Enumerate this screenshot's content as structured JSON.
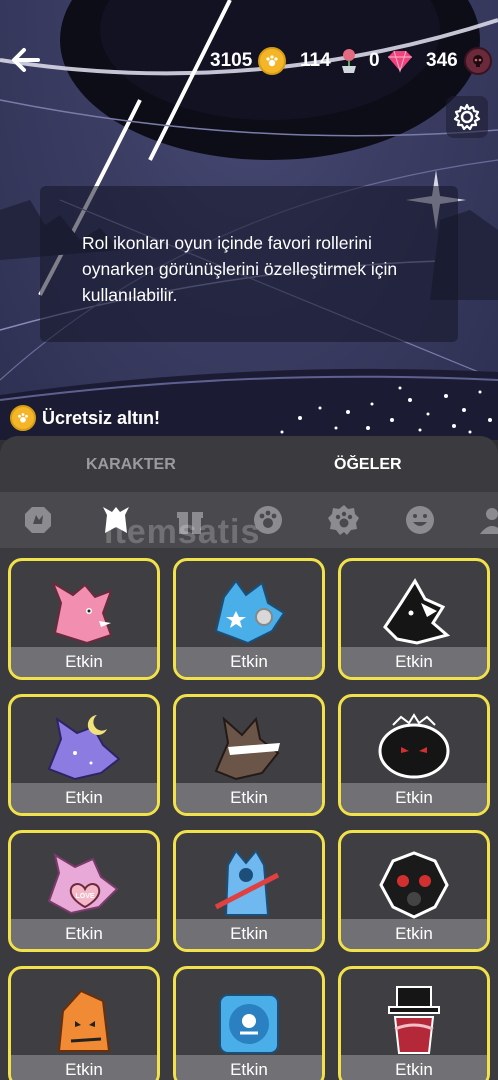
{
  "header": {
    "coins": "3105",
    "roses": "114",
    "gems_pink": "0",
    "gems_skull": "346"
  },
  "info": {
    "text": "Rol ikonları oyun içinde favori rollerini oynarken görünüşlerini özelleştirmek için kullanılabilir."
  },
  "free_gold": {
    "label": "Ücretsiz altın!"
  },
  "tabs": [
    {
      "label": "KARAKTER",
      "active": false
    },
    {
      "label": "ÖĞELER",
      "active": true
    }
  ],
  "category_icons": [
    "badge-icon",
    "wolf-head-icon",
    "gift-icon",
    "paw-icon",
    "paw-badge-icon",
    "smile-icon",
    "person-icon"
  ],
  "watermark": "itemsatis",
  "items": [
    {
      "name": "pink-wolf",
      "label": "Etkin"
    },
    {
      "name": "blue-star-wolf",
      "label": "Etkin"
    },
    {
      "name": "black-white-dragon",
      "label": "Etkin"
    },
    {
      "name": "night-moon-wolf",
      "label": "Etkin"
    },
    {
      "name": "masked-brown-wolf",
      "label": "Etkin"
    },
    {
      "name": "black-lace-wolf",
      "label": "Etkin"
    },
    {
      "name": "love-wolf",
      "label": "Etkin"
    },
    {
      "name": "blue-cat-guitar",
      "label": "Etkin"
    },
    {
      "name": "gasmask-wolf",
      "label": "Etkin"
    },
    {
      "name": "fire-note-wolf",
      "label": "Etkin"
    },
    {
      "name": "vinyl-skull",
      "label": "Etkin"
    },
    {
      "name": "tophat-snake",
      "label": "Etkin"
    }
  ]
}
